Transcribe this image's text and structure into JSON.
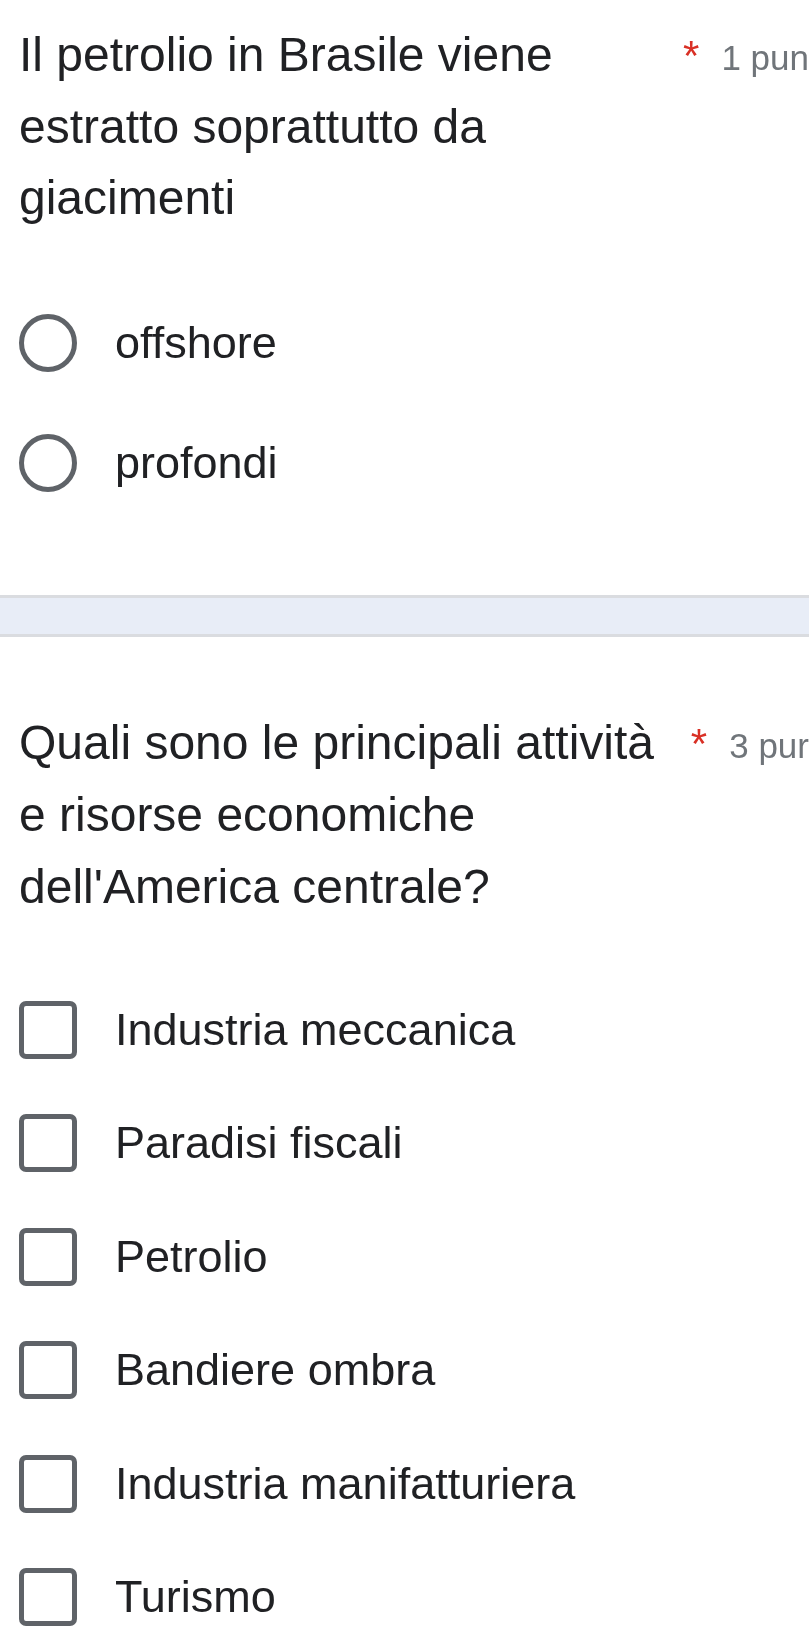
{
  "questions": [
    {
      "kind": "radio",
      "title": "Il petrolio in Brasile viene estratto soprattutto da giacimenti",
      "required_mark": "*",
      "points": "1 pun",
      "options": [
        {
          "label": "offshore",
          "selected": false
        },
        {
          "label": "profondi",
          "selected": false
        }
      ]
    },
    {
      "kind": "checkbox",
      "title": "Quali sono le principali attività e risorse economiche dell'America centrale?",
      "required_mark": "*",
      "points": "3 pur",
      "options": [
        {
          "label": "Industria meccanica",
          "checked": false
        },
        {
          "label": "Paradisi fiscali",
          "checked": false
        },
        {
          "label": "Petrolio",
          "checked": false
        },
        {
          "label": "Bandiere ombra",
          "checked": false
        },
        {
          "label": "Industria manifatturiera",
          "checked": false
        },
        {
          "label": "Turismo",
          "checked": false
        }
      ]
    }
  ]
}
